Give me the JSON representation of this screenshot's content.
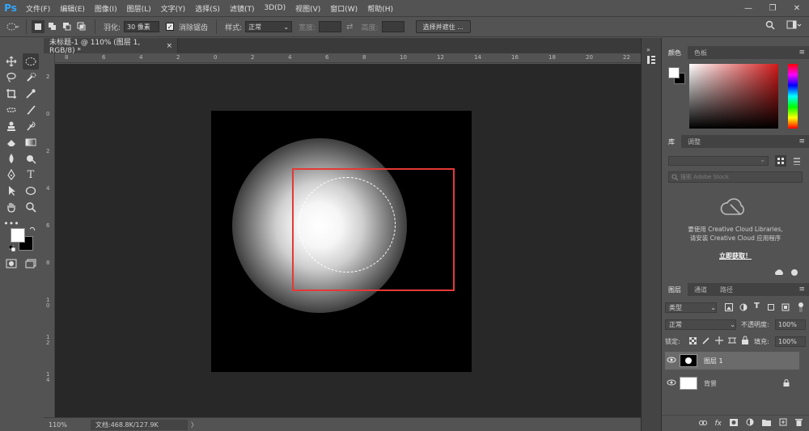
{
  "app": {
    "logo": "Ps"
  },
  "menu": [
    "文件(F)",
    "编辑(E)",
    "图像(I)",
    "图层(L)",
    "文字(Y)",
    "选择(S)",
    "滤镜(T)",
    "3D(D)",
    "视图(V)",
    "窗口(W)",
    "帮助(H)"
  ],
  "window_controls": {
    "minimize": "—",
    "restore": "❐",
    "close": "✕"
  },
  "options": {
    "feather_label": "羽化:",
    "feather_value": "30 像素",
    "antialias_label": "消除锯齿",
    "style_label": "样式:",
    "style_value": "正常",
    "width_label": "宽度:",
    "height_label": "高度:",
    "select_mask_button": "选择并遮住 ..."
  },
  "document": {
    "tab_title": "未标题-1 @ 110% (图层 1, RGB/8) *",
    "tab_close": "×"
  },
  "ruler_h": [
    "8",
    "6",
    "4",
    "2",
    "0",
    "2",
    "4",
    "6",
    "8",
    "10",
    "12",
    "14",
    "16",
    "18",
    "20",
    "22"
  ],
  "ruler_v": [
    "2",
    "0",
    "2",
    "4",
    "6",
    "8",
    "1 0",
    "1 2",
    "1 4"
  ],
  "status": {
    "zoom": "110%",
    "doc_info": "文档:468.8K/127.9K",
    "arrow": "〉"
  },
  "color_panel": {
    "tabs": [
      "颜色",
      "色板"
    ]
  },
  "library_panel": {
    "tabs": [
      "库",
      "调整"
    ],
    "search_placeholder": "搜索 Adobe Stock",
    "message_line1": "要使用 Creative Cloud Libraries,",
    "message_line2": "请安装 Creative Cloud 应用程序",
    "link": "立即获取！"
  },
  "layers_panel": {
    "tabs": [
      "图层",
      "通道",
      "路径"
    ],
    "filter_label": "类型",
    "blend_mode": "正常",
    "opacity_label": "不透明度:",
    "opacity_value": "100%",
    "lock_label": "锁定:",
    "fill_label": "填充:",
    "fill_value": "100%",
    "layers": [
      {
        "name": "图层 1"
      },
      {
        "name": "背景"
      }
    ],
    "footer_icons": [
      "link-icon",
      "fx-icon",
      "mask-icon",
      "adjustment-icon",
      "folder-icon",
      "new-layer-icon",
      "trash-icon"
    ]
  },
  "colors": {
    "accent": "#31a8ff",
    "highlight_box": "#e53935",
    "panel_bg": "#535353"
  }
}
